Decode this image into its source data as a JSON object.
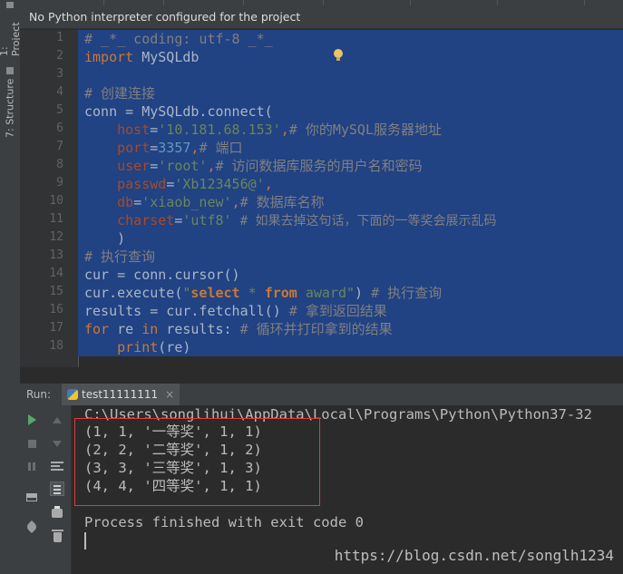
{
  "sidebar": {
    "project_tab": "1: Project",
    "structure_tab": "7: Structure"
  },
  "banner": {
    "text": "No Python interpreter configured for the project"
  },
  "editor": {
    "line_numbers": [
      "1",
      "2",
      "3",
      "4",
      "5",
      "6",
      "7",
      "8",
      "9",
      "10",
      "11",
      "12",
      "13",
      "14",
      "15",
      "16",
      "17",
      "18"
    ]
  },
  "code": {
    "l1": "# _*_ coding: utf-8 _*_",
    "l2_kw": "import",
    "l2_rest": " MySQLdb",
    "l4": "# 创建连接",
    "l5": "conn = MySQLdb.connect(",
    "l6_p": "host",
    "l6_eq": "=",
    "l6_s": "'10.181.68.153'",
    "l6_c1": ",",
    "l6_c": "# 你的MySQL服务器地址",
    "l7_p": "port",
    "l7_eq": "=",
    "l7_n": "3357",
    "l7_c1": ",",
    "l7_c": "# 端口",
    "l8_p": "user",
    "l8_eq": "=",
    "l8_s": "'root'",
    "l8_c1": ",",
    "l8_c": "# 访问数据库服务的用户名和密码",
    "l9_p": "passwd",
    "l9_eq": "=",
    "l9_s": "'Xb123456@'",
    "l9_c1": ",",
    "l10_p": "db",
    "l10_eq": "=",
    "l10_s": "'xiaob_new'",
    "l10_c1": ",",
    "l10_c": "# 数据库名称",
    "l11_p": "charset",
    "l11_eq": "=",
    "l11_s": "'utf8'",
    "l11_c": "# 如果去掉这句话，下面的一等奖会展示乱码",
    "l12": ")",
    "l13": "# 执行查询",
    "l14": "cur = conn.cursor()",
    "l15_a": "cur.execute(",
    "l15_s1": "\"",
    "l15_k1": "select",
    "l15_m": " * ",
    "l15_k2": "from",
    "l15_s2": " award\"",
    "l15_b": ")",
    "l15_c": "# 执行查询",
    "l16_a": "results = cur.fetchall()",
    "l16_c": "# 拿到返回结果",
    "l17_k1": "for",
    "l17_a": " re ",
    "l17_k2": "in",
    "l17_b": " results:",
    "l17_c": "# 循环并打印拿到的结果",
    "l18_k": "print",
    "l18_a": "(re)"
  },
  "run_panel": {
    "label": "Run:",
    "tab_name": "test11111111",
    "close": "×"
  },
  "console": {
    "path": "C:\\Users\\songlihui\\AppData\\Local\\Programs\\Python\\Python37-32",
    "rows": [
      "(1, 1, '一等奖', 1, 1)",
      "(2, 2, '二等奖', 1, 2)",
      "(3, 3, '三等奖', 1, 3)",
      "(4, 4, '四等奖', 1, 1)"
    ],
    "finished": "Process finished with exit code 0"
  },
  "watermark": "https://blog.csdn.net/songlh1234"
}
